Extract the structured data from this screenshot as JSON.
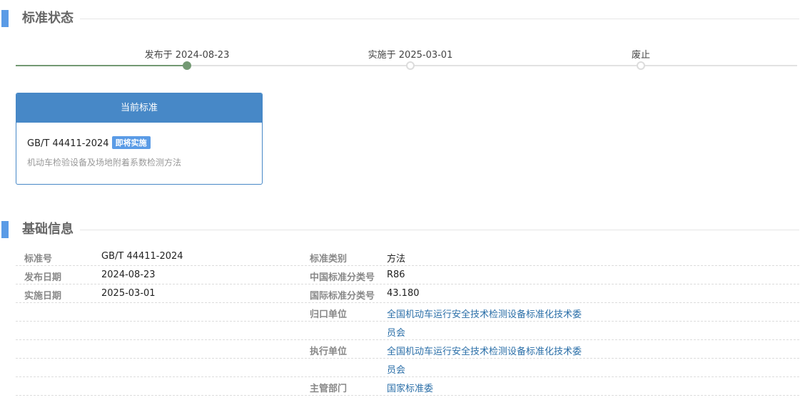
{
  "status_section": {
    "title": "标准状态",
    "timeline": [
      {
        "label": "发布于 2024-08-23",
        "state": "active"
      },
      {
        "label": "实施于 2025-03-01",
        "state": "pending"
      },
      {
        "label": "废止",
        "state": "pending"
      }
    ]
  },
  "current_card": {
    "header": "当前标准",
    "code": "GB/T 44411-2024",
    "badge": "即将实施",
    "name": "机动车检验设备及场地附着系数检测方法"
  },
  "basic_section": {
    "title": "基础信息",
    "rows": [
      {
        "l1": "标准号",
        "v1": "GB/T 44411-2024",
        "l2": "标准类别",
        "v2": "方法"
      },
      {
        "l1": "发布日期",
        "v1": "2024-08-23",
        "l2": "中国标准分类号",
        "v2": "R86"
      },
      {
        "l1": "实施日期",
        "v1": "2025-03-01",
        "l2": "国际标准分类号",
        "v2": "43.180"
      },
      {
        "l1": "",
        "v1": "",
        "l2": "归口单位",
        "v2": "全国机动车运行安全技术检测设备标准化技术委"
      },
      {
        "l1": "",
        "v1": "",
        "l2": "",
        "v2": "员会"
      },
      {
        "l1": "",
        "v1": "",
        "l2": "执行单位",
        "v2": "全国机动车运行安全技术检测设备标准化技术委"
      },
      {
        "l1": "",
        "v1": "",
        "l2": "",
        "v2": "员会"
      },
      {
        "l1": "",
        "v1": "",
        "l2": "主管部门",
        "v2": "国家标准委"
      }
    ]
  },
  "colors": {
    "accent": "#4788c7",
    "section_bar": "#5a9be6",
    "timeline_done": "#739973",
    "link": "#2b6fa8"
  }
}
